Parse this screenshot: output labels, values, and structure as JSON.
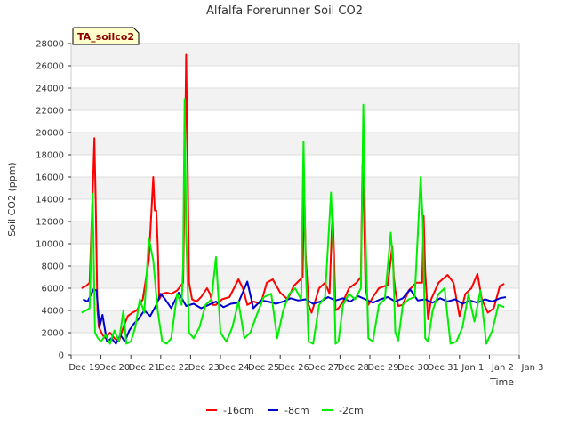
{
  "chart_data": {
    "type": "line",
    "title": "Alfalfa Forerunner Soil CO2",
    "badge": "TA_soilco2",
    "xlabel": "Time",
    "ylabel": "Soil CO2 (ppm)",
    "xlim": [
      "Dec 19",
      "Jan 3"
    ],
    "ylim": [
      0,
      28000
    ],
    "y_ticks": [
      0,
      2000,
      4000,
      6000,
      8000,
      10000,
      12000,
      14000,
      16000,
      18000,
      20000,
      22000,
      24000,
      26000,
      28000
    ],
    "x_tick_labels": [
      "Dec 19",
      "Dec 20",
      "Dec 21",
      "Dec 22",
      "Dec 23",
      "Dec 24",
      "Dec 25",
      "Dec 26",
      "Dec 27",
      "Dec 28",
      "Dec 29",
      "Dec 30",
      "Dec 31",
      "Jan 1",
      "Jan 2",
      "Jan 3"
    ],
    "grid": true,
    "background_bands": true,
    "legend_position": "bottom-center",
    "series": [
      {
        "name": "-16cm",
        "color": "#ff0000",
        "x": [
          0.35,
          0.5,
          0.62,
          0.72,
          0.78,
          0.82,
          0.88,
          0.93,
          1.05,
          1.15,
          1.3,
          1.45,
          1.6,
          1.75,
          1.9,
          2.05,
          2.2,
          2.4,
          2.6,
          2.75,
          2.8,
          2.85,
          2.9,
          2.95,
          3.05,
          3.2,
          3.35,
          3.55,
          3.75,
          3.8,
          3.85,
          3.9,
          3.95,
          4.05,
          4.2,
          4.35,
          4.55,
          4.65,
          4.75,
          4.85,
          5.05,
          5.3,
          5.6,
          5.75,
          5.9,
          6.1,
          6.35,
          6.55,
          6.75,
          7.0,
          7.25,
          7.45,
          7.75,
          7.8,
          7.85,
          7.95,
          8.05,
          8.3,
          8.5,
          8.65,
          8.75,
          8.8,
          8.85,
          8.95,
          9.1,
          9.3,
          9.55,
          9.7,
          9.75,
          9.8,
          9.85,
          9.95,
          10.1,
          10.3,
          10.6,
          10.75,
          10.8,
          10.85,
          10.95,
          11.1,
          11.3,
          11.55,
          11.75,
          11.8,
          11.85,
          11.95,
          12.05,
          12.3,
          12.6,
          12.8,
          13.0,
          13.2,
          13.4,
          13.6,
          13.75,
          13.95,
          14.15,
          14.35,
          14.5
        ],
        "y": [
          6000,
          6200,
          6500,
          14500,
          19500,
          14000,
          4000,
          2500,
          1800,
          1500,
          2000,
          1500,
          1200,
          2500,
          3500,
          3800,
          4000,
          5000,
          8500,
          16000,
          13000,
          13000,
          10000,
          5000,
          5500,
          5600,
          5500,
          5800,
          6500,
          15000,
          27000,
          18000,
          6500,
          5000,
          4800,
          5200,
          6000,
          5500,
          4500,
          4500,
          5000,
          5200,
          6800,
          6000,
          4500,
          4800,
          4600,
          6500,
          6800,
          5600,
          5000,
          6200,
          7000,
          15000,
          9000,
          4500,
          3800,
          6000,
          6500,
          5500,
          13000,
          9000,
          4000,
          4200,
          4800,
          6000,
          6500,
          7000,
          17000,
          13000,
          6200,
          4500,
          5200,
          6000,
          6300,
          9800,
          7000,
          5800,
          4400,
          4500,
          5800,
          6500,
          6500,
          12500,
          7500,
          3200,
          5000,
          6500,
          7200,
          6500,
          3500,
          5500,
          6000,
          7300,
          5000,
          3800,
          4200,
          6200,
          6400
        ]
      },
      {
        "name": "-8cm",
        "color": "#0000cc",
        "x": [
          0.4,
          0.55,
          0.75,
          0.85,
          0.95,
          1.05,
          1.2,
          1.35,
          1.5,
          1.65,
          1.8,
          1.95,
          2.1,
          2.25,
          2.45,
          2.65,
          2.85,
          3.0,
          3.15,
          3.35,
          3.6,
          3.85,
          4.1,
          4.35,
          4.6,
          4.85,
          5.1,
          5.35,
          5.6,
          5.9,
          6.1,
          6.35,
          6.6,
          6.85,
          7.1,
          7.35,
          7.6,
          7.85,
          8.1,
          8.35,
          8.6,
          8.85,
          9.1,
          9.35,
          9.6,
          9.85,
          10.1,
          10.35,
          10.6,
          10.85,
          11.1,
          11.35,
          11.6,
          11.85,
          12.1,
          12.35,
          12.6,
          12.85,
          13.1,
          13.35,
          13.6,
          13.85,
          14.1,
          14.35,
          14.55
        ],
        "y": [
          5000,
          4800,
          5900,
          5800,
          2500,
          3600,
          1200,
          1500,
          1000,
          1800,
          1200,
          2200,
          2800,
          3200,
          4000,
          3500,
          4500,
          5500,
          5000,
          4200,
          5600,
          4400,
          4600,
          4200,
          4500,
          4800,
          4300,
          4600,
          4700,
          6600,
          4200,
          4900,
          4800,
          4600,
          4800,
          5100,
          4900,
          5000,
          4600,
          4800,
          5200,
          4900,
          5100,
          4800,
          5300,
          5000,
          4700,
          5000,
          5200,
          4800,
          5100,
          5900,
          4900,
          5000,
          4700,
          5100,
          4800,
          5000,
          4600,
          4900,
          4700,
          5000,
          4800,
          5100,
          5200
        ]
      },
      {
        "name": "-2cm",
        "color": "#00ee00",
        "x": [
          0.35,
          0.5,
          0.62,
          0.72,
          0.8,
          0.9,
          1.0,
          1.15,
          1.3,
          1.45,
          1.6,
          1.75,
          1.85,
          2.0,
          2.15,
          2.3,
          2.45,
          2.6,
          2.75,
          2.9,
          3.05,
          3.2,
          3.35,
          3.55,
          3.7,
          3.75,
          3.8,
          3.85,
          3.95,
          4.1,
          4.3,
          4.5,
          4.7,
          4.85,
          5.0,
          5.2,
          5.4,
          5.6,
          5.8,
          6.0,
          6.2,
          6.45,
          6.7,
          6.9,
          7.1,
          7.3,
          7.5,
          7.7,
          7.78,
          7.85,
          7.95,
          8.1,
          8.3,
          8.5,
          8.7,
          8.78,
          8.85,
          8.95,
          9.1,
          9.3,
          9.5,
          9.7,
          9.78,
          9.85,
          9.95,
          10.1,
          10.3,
          10.5,
          10.7,
          10.78,
          10.85,
          10.95,
          11.1,
          11.3,
          11.5,
          11.7,
          11.77,
          11.85,
          11.95,
          12.1,
          12.3,
          12.5,
          12.7,
          12.9,
          13.1,
          13.3,
          13.5,
          13.7,
          13.9,
          14.1,
          14.3,
          14.5
        ],
        "y": [
          3800,
          4000,
          4200,
          14500,
          2000,
          1500,
          1200,
          1800,
          1000,
          2200,
          1200,
          4000,
          1000,
          1200,
          2500,
          5000,
          3800,
          10500,
          8500,
          4000,
          1200,
          1000,
          1500,
          5500,
          4500,
          8000,
          23000,
          11000,
          2000,
          1500,
          2500,
          4500,
          5000,
          8800,
          2000,
          1200,
          2500,
          4800,
          1500,
          2000,
          3500,
          5200,
          5500,
          1500,
          4000,
          5500,
          6000,
          5000,
          19200,
          8000,
          1200,
          1000,
          4500,
          5200,
          14600,
          9000,
          1000,
          1200,
          4500,
          5500,
          5000,
          6000,
          22500,
          11000,
          1500,
          1200,
          4500,
          5000,
          11000,
          8000,
          2000,
          1300,
          4500,
          5000,
          5200,
          16000,
          12000,
          1500,
          1200,
          4000,
          5500,
          6000,
          1000,
          1200,
          2500,
          5500,
          3000,
          5800,
          1000,
          2200,
          4500,
          4300
        ]
      }
    ]
  }
}
